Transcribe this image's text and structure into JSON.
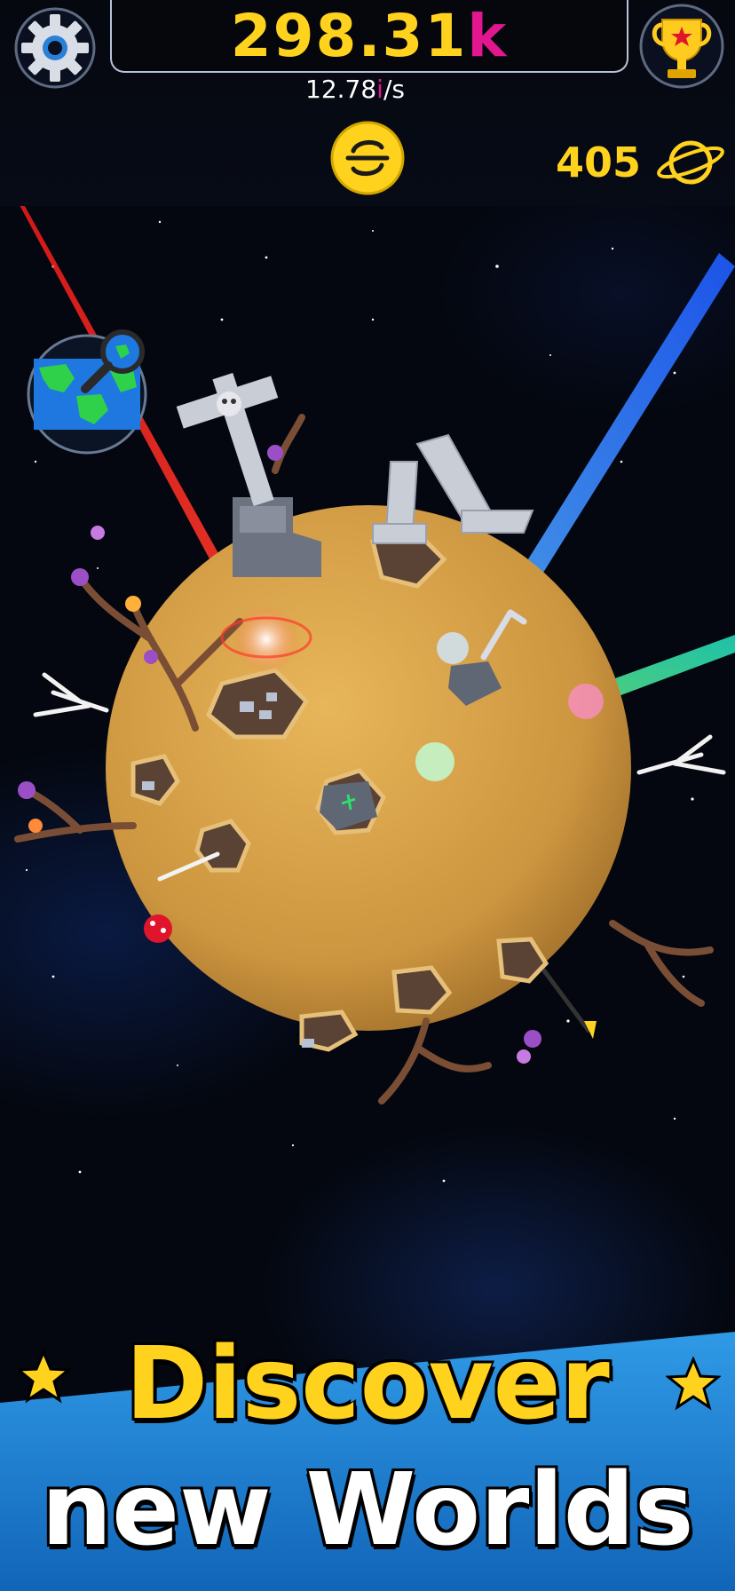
{
  "header": {
    "score_value": "298.31",
    "score_unit": "k",
    "rate_value": "12.78",
    "rate_unit": "i",
    "rate_suffix": "/s",
    "planets_count": "405"
  },
  "icons": {
    "settings": "gear-icon",
    "trophy": "trophy-icon",
    "coin": "coin-icon",
    "planet": "planet-icon",
    "world_map": "world-map-icon",
    "star": "star-icon"
  },
  "promo": {
    "line1": "Discover",
    "line2": "new Worlds"
  },
  "colors": {
    "accent_yellow": "#ffd21e",
    "accent_magenta": "#e2178f",
    "banner_blue": "#1f86d8",
    "planet_surface": "#d6a24a"
  }
}
